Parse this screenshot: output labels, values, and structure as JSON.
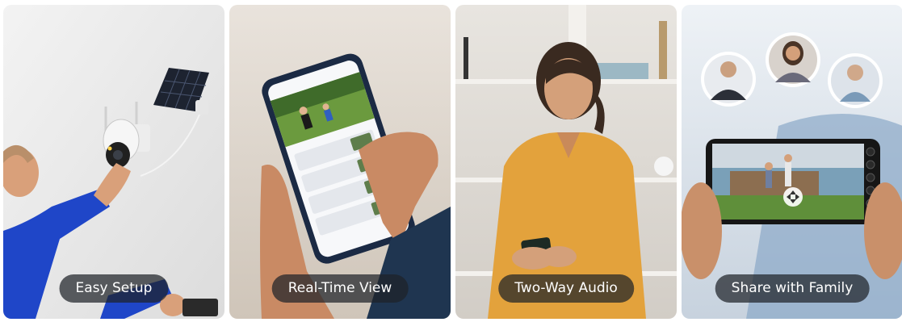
{
  "panels": [
    {
      "caption": "Easy Setup"
    },
    {
      "caption": "Real-Time View"
    },
    {
      "caption": "Two-Way Audio"
    },
    {
      "caption": "Share with Family"
    }
  ],
  "colors": {
    "caption_bg": "#1e2228",
    "caption_text": "#ffffff"
  }
}
